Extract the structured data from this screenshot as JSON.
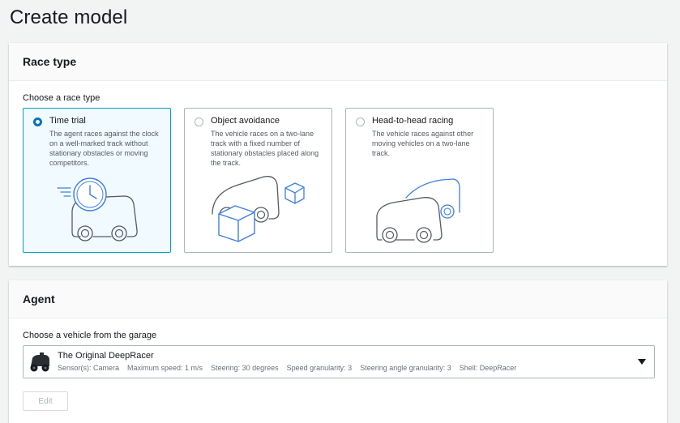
{
  "page": {
    "title": "Create model"
  },
  "race_type": {
    "header": "Race type",
    "field_label": "Choose a race type",
    "options": [
      {
        "title": "Time trial",
        "description": "The agent races against the clock on a well-marked track without stationary obstacles or moving competitors.",
        "selected": true,
        "icon": "time-trial-car-clock-icon"
      },
      {
        "title": "Object avoidance",
        "description": "The vehicle races on a two-lane track with a fixed number of stationary obstacles placed along the track.",
        "selected": false,
        "icon": "object-avoidance-car-box-icon"
      },
      {
        "title": "Head-to-head racing",
        "description": "The vehicle races against other moving vehicles on a two-lane track.",
        "selected": false,
        "icon": "head-to-head-two-cars-icon"
      }
    ]
  },
  "agent": {
    "header": "Agent",
    "field_label": "Choose a vehicle from the garage",
    "vehicle": {
      "name": "The Original DeepRacer",
      "icon": "deepracer-vehicle-icon",
      "specs": [
        "Sensor(s): Camera",
        "Maximum speed: 1 m/s",
        "Steering: 30 degrees",
        "Speed granularity: 3",
        "Steering angle granularity: 3",
        "Shell: DeepRacer"
      ]
    },
    "edit_label": "Edit"
  },
  "colors": {
    "selected_border": "#00a1c9",
    "selected_background": "#f1faff",
    "radio_checked": "#0073bb",
    "illustration_blue": "#3f7fe0",
    "illustration_gray": "#545b64"
  }
}
